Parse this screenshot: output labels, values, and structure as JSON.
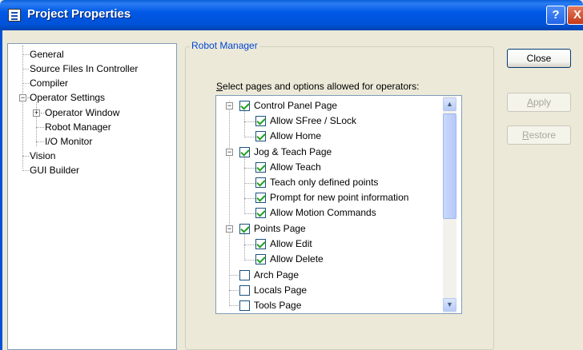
{
  "window": {
    "title": "Project Properties",
    "help_label": "?",
    "close_label": "X"
  },
  "left_tree": {
    "items": [
      {
        "label": "General"
      },
      {
        "label": "Source Files In Controller"
      },
      {
        "label": "Compiler"
      },
      {
        "label": "Operator Settings",
        "expander": "−"
      },
      {
        "label": "Operator Window",
        "expander": "+"
      },
      {
        "label": "Robot Manager"
      },
      {
        "label": "I/O Monitor"
      },
      {
        "label": "Vision"
      },
      {
        "label": "GUI Builder"
      }
    ]
  },
  "panel": {
    "group_title": "Robot Manager",
    "select_label_accel": "S",
    "select_label_rest": "elect pages and options allowed for operators:"
  },
  "options": [
    {
      "label": "Control Panel Page",
      "checked": true,
      "expander": "−"
    },
    {
      "label": "Allow SFree / SLock",
      "checked": true
    },
    {
      "label": "Allow Home",
      "checked": true
    },
    {
      "label": "Jog & Teach Page",
      "checked": true,
      "expander": "−"
    },
    {
      "label": "Allow Teach",
      "checked": true
    },
    {
      "label": "Teach only defined points",
      "checked": true
    },
    {
      "label": "Prompt for new point information",
      "checked": true
    },
    {
      "label": "Allow Motion Commands",
      "checked": true
    },
    {
      "label": "Points Page",
      "checked": true,
      "expander": "−"
    },
    {
      "label": "Allow Edit",
      "checked": true
    },
    {
      "label": "Allow Delete",
      "checked": true
    },
    {
      "label": "Arch Page",
      "checked": false
    },
    {
      "label": "Locals Page",
      "checked": false
    },
    {
      "label": "Tools Page",
      "checked": false
    }
  ],
  "buttons": {
    "close": "Close",
    "apply_accel": "A",
    "apply_rest": "pply",
    "restore_accel": "R",
    "restore_rest": "estore"
  },
  "colors": {
    "title_bar": "#0053d8",
    "group_title": "#0046d5",
    "check": "#21a121"
  }
}
